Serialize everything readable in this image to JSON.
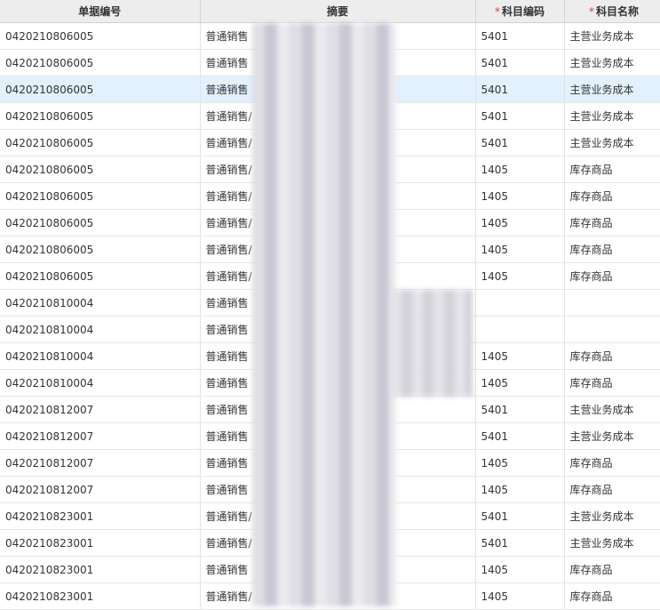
{
  "grid": {
    "headers": {
      "doc_no": "单据编号",
      "summary": "摘要",
      "account_code": "科目编码",
      "account_name": "科目名称",
      "required_mark": "*"
    },
    "rows": [
      {
        "doc_no": "0420210806005",
        "summary": "普通销售",
        "account_code": "5401",
        "account_name": "主营业务成本"
      },
      {
        "doc_no": "0420210806005",
        "summary": "普通销售",
        "account_code": "5401",
        "account_name": "主营业务成本"
      },
      {
        "doc_no": "0420210806005",
        "summary": "普通销售",
        "account_code": "5401",
        "account_name": "主营业务成本"
      },
      {
        "doc_no": "0420210806005",
        "summary": "普通销售/",
        "account_code": "5401",
        "account_name": "主营业务成本"
      },
      {
        "doc_no": "0420210806005",
        "summary": "普通销售/",
        "account_code": "5401",
        "account_name": "主营业务成本"
      },
      {
        "doc_no": "0420210806005",
        "summary": "普通销售/",
        "account_code": "1405",
        "account_name": "库存商品"
      },
      {
        "doc_no": "0420210806005",
        "summary": "普通销售/",
        "account_code": "1405",
        "account_name": "库存商品"
      },
      {
        "doc_no": "0420210806005",
        "summary": "普通销售/",
        "account_code": "1405",
        "account_name": "库存商品"
      },
      {
        "doc_no": "0420210806005",
        "summary": "普通销售/",
        "account_code": "1405",
        "account_name": "库存商品"
      },
      {
        "doc_no": "0420210806005",
        "summary": "普通销售/",
        "account_code": "1405",
        "account_name": "库存商品"
      },
      {
        "doc_no": "0420210810004",
        "summary": "普通销售",
        "account_code": "",
        "account_name": ""
      },
      {
        "doc_no": "0420210810004",
        "summary": "普通销售",
        "account_code": "",
        "account_name": ""
      },
      {
        "doc_no": "0420210810004",
        "summary": "普通销售",
        "account_code": "1405",
        "account_name": "库存商品"
      },
      {
        "doc_no": "0420210810004",
        "summary": "普通销售",
        "account_code": "1405",
        "account_name": "库存商品"
      },
      {
        "doc_no": "0420210812007",
        "summary": "普通销售",
        "account_code": "5401",
        "account_name": "主营业务成本"
      },
      {
        "doc_no": "0420210812007",
        "summary": "普通销售",
        "account_code": "5401",
        "account_name": "主营业务成本"
      },
      {
        "doc_no": "0420210812007",
        "summary": "普通销售",
        "account_code": "1405",
        "account_name": "库存商品"
      },
      {
        "doc_no": "0420210812007",
        "summary": "普通销售",
        "account_code": "1405",
        "account_name": "库存商品"
      },
      {
        "doc_no": "0420210823001",
        "summary": "普通销售/",
        "account_code": "5401",
        "account_name": "主营业务成本"
      },
      {
        "doc_no": "0420210823001",
        "summary": "普通销售/",
        "account_code": "5401",
        "account_name": "主营业务成本"
      },
      {
        "doc_no": "0420210823001",
        "summary": "普通销售",
        "account_code": "1405",
        "account_name": "库存商品"
      },
      {
        "doc_no": "0420210823001",
        "summary": "普通销售/",
        "account_code": "1405",
        "account_name": "库存商品"
      }
    ],
    "selected_row": 2
  }
}
